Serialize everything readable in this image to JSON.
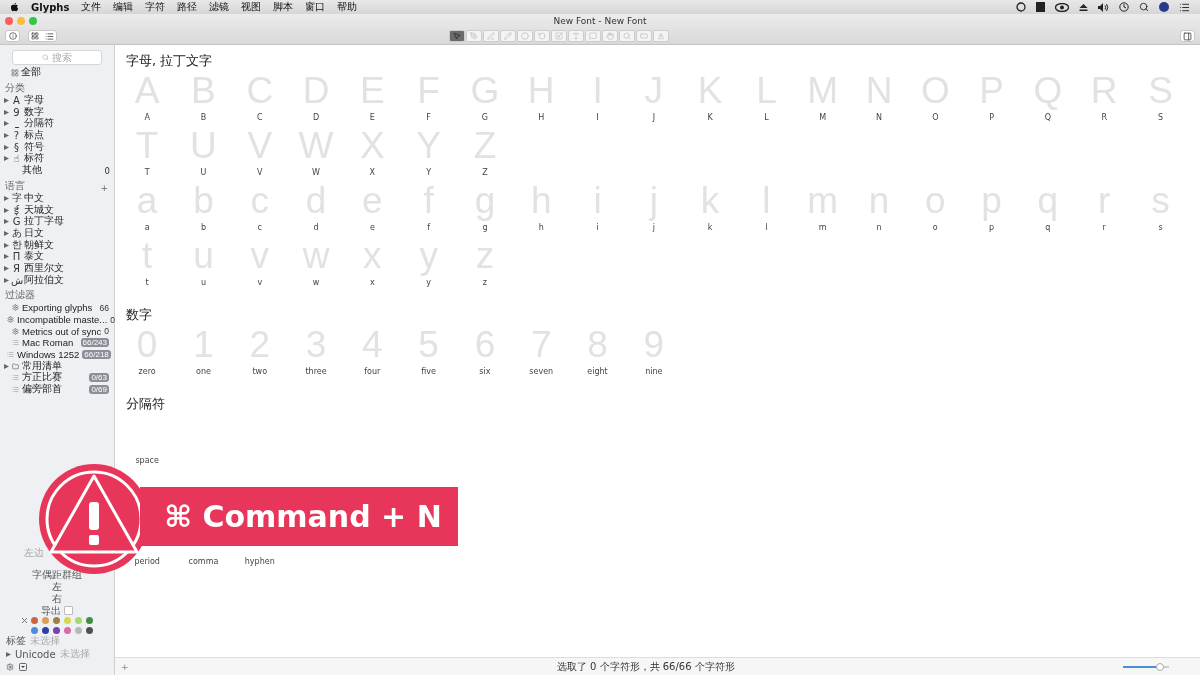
{
  "menu_bar": {
    "app": "Glyphs",
    "items": [
      "文件",
      "编辑",
      "字符",
      "路径",
      "滤镜",
      "视图",
      "脚本",
      "窗口",
      "帮助"
    ]
  },
  "window": {
    "title": "New Font - New Font"
  },
  "tools": [
    {
      "selected": true
    },
    {
      "selected": false
    },
    {
      "selected": false
    },
    {
      "selected": false
    },
    {
      "selected": false
    },
    {
      "selected": false
    },
    {
      "selected": false
    },
    {
      "selected": false
    },
    {
      "selected": false
    },
    {
      "selected": false
    },
    {
      "selected": false
    },
    {
      "selected": false
    },
    {
      "selected": false
    }
  ],
  "sidebar": {
    "search": {
      "placeholder": "搜索"
    },
    "all": "全部",
    "categories": {
      "title": "分类",
      "items": [
        {
          "symbol": "A",
          "label": "字母",
          "expanded": false
        },
        {
          "symbol": "9",
          "label": "数字",
          "expanded": false
        },
        {
          "symbol": "⎵",
          "label": "分隔符",
          "expanded": false
        },
        {
          "symbol": "?",
          "label": "标点",
          "expanded": false
        },
        {
          "symbol": "§",
          "label": "符号",
          "expanded": false
        },
        {
          "symbol": "☝",
          "label": "标符",
          "expanded": false
        },
        {
          "label": "其他",
          "count": "0"
        }
      ]
    },
    "languages": {
      "title": "语言",
      "add": "+",
      "items": [
        {
          "symbol": "字",
          "label": "中文",
          "expanded": false
        },
        {
          "symbol": "ई",
          "label": "天城文",
          "expanded": false
        },
        {
          "symbol": "G",
          "label": "拉丁字母",
          "expanded": false
        },
        {
          "symbol": "あ",
          "label": "日文",
          "expanded": false
        },
        {
          "symbol": "한",
          "label": "朝鲜文",
          "expanded": false
        },
        {
          "symbol": "П",
          "label": "泰文",
          "expanded": false
        },
        {
          "symbol": "Я",
          "label": "西里尔文",
          "expanded": false
        },
        {
          "symbol": "ش",
          "label": "阿拉伯文",
          "expanded": false
        }
      ]
    },
    "filters": {
      "title": "过滤器",
      "items": [
        {
          "kind": "smart",
          "label": "Exporting glyphs",
          "count": "66"
        },
        {
          "kind": "smart",
          "label": "Incompatible maste...",
          "count": "0"
        },
        {
          "kind": "smart",
          "label": "Metrics out of sync",
          "count": "0"
        },
        {
          "kind": "list",
          "label": "Mac Roman",
          "count": "66/243"
        },
        {
          "kind": "list",
          "label": "Windows 1252",
          "count": "66/218"
        },
        {
          "kind": "folder",
          "label": "常用清单",
          "expanded": false
        },
        {
          "kind": "list",
          "label": "方正比赛",
          "count": "0/63"
        },
        {
          "kind": "list",
          "label": "偏旁部首",
          "count": "0/69"
        }
      ]
    },
    "panel": {
      "left_margin": "左边",
      "kerning_group": "字偶距群组",
      "left": "左",
      "right": "右",
      "export": {
        "label": "导出",
        "checked": false
      },
      "colors": [
        {
          "color": "#c8673f"
        },
        {
          "color": "#d9a055"
        },
        {
          "color": "#9c8048"
        },
        {
          "color": "#d8d84a"
        },
        {
          "color": "#a8d870"
        },
        {
          "color": "#3f8f3f"
        },
        {
          "color": "#4a90d9"
        },
        {
          "color": "#2b3fa8"
        },
        {
          "color": "#7a3fb0"
        },
        {
          "color": "#d86aa8"
        },
        {
          "color": "#b8b8b8"
        },
        {
          "color": "#505050"
        }
      ],
      "tags": {
        "label": "标签",
        "value": "未选择"
      },
      "unicode": {
        "label": "Unicode",
        "value": "未选择",
        "expanded": false
      }
    }
  },
  "sections": [
    {
      "title": "字母, 拉丁文字",
      "groups": [
        [
          {
            "char": "A",
            "name": "A"
          },
          {
            "char": "B",
            "name": "B"
          },
          {
            "char": "C",
            "name": "C"
          },
          {
            "char": "D",
            "name": "D"
          },
          {
            "char": "E",
            "name": "E"
          },
          {
            "char": "F",
            "name": "F"
          },
          {
            "char": "G",
            "name": "G"
          },
          {
            "char": "H",
            "name": "H"
          },
          {
            "char": "I",
            "name": "I"
          },
          {
            "char": "J",
            "name": "J"
          },
          {
            "char": "K",
            "name": "K"
          },
          {
            "char": "L",
            "name": "L"
          },
          {
            "char": "M",
            "name": "M"
          },
          {
            "char": "N",
            "name": "N"
          },
          {
            "char": "O",
            "name": "O"
          },
          {
            "char": "P",
            "name": "P"
          },
          {
            "char": "Q",
            "name": "Q"
          },
          {
            "char": "R",
            "name": "R"
          },
          {
            "char": "S",
            "name": "S"
          },
          {
            "char": "T",
            "name": "T"
          },
          {
            "char": "U",
            "name": "U"
          },
          {
            "char": "V",
            "name": "V"
          },
          {
            "char": "W",
            "name": "W"
          },
          {
            "char": "X",
            "name": "X"
          },
          {
            "char": "Y",
            "name": "Y"
          },
          {
            "char": "Z",
            "name": "Z"
          }
        ],
        [
          {
            "char": "a",
            "name": "a"
          },
          {
            "char": "b",
            "name": "b"
          },
          {
            "char": "c",
            "name": "c"
          },
          {
            "char": "d",
            "name": "d"
          },
          {
            "char": "e",
            "name": "e"
          },
          {
            "char": "f",
            "name": "f"
          },
          {
            "char": "g",
            "name": "g"
          },
          {
            "char": "h",
            "name": "h"
          },
          {
            "char": "i",
            "name": "i"
          },
          {
            "char": "j",
            "name": "j"
          },
          {
            "char": "k",
            "name": "k"
          },
          {
            "char": "l",
            "name": "l"
          },
          {
            "char": "m",
            "name": "m"
          },
          {
            "char": "n",
            "name": "n"
          },
          {
            "char": "o",
            "name": "o"
          },
          {
            "char": "p",
            "name": "p"
          },
          {
            "char": "q",
            "name": "q"
          },
          {
            "char": "r",
            "name": "r"
          },
          {
            "char": "s",
            "name": "s"
          },
          {
            "char": "t",
            "name": "t"
          },
          {
            "char": "u",
            "name": "u"
          },
          {
            "char": "v",
            "name": "v"
          },
          {
            "char": "w",
            "name": "w"
          },
          {
            "char": "x",
            "name": "x"
          },
          {
            "char": "y",
            "name": "y"
          },
          {
            "char": "z",
            "name": "z"
          }
        ]
      ]
    },
    {
      "title": "数字",
      "groups": [
        [
          {
            "char": "0",
            "name": "zero"
          },
          {
            "char": "1",
            "name": "one"
          },
          {
            "char": "2",
            "name": "two"
          },
          {
            "char": "3",
            "name": "three"
          },
          {
            "char": "4",
            "name": "four"
          },
          {
            "char": "5",
            "name": "five"
          },
          {
            "char": "6",
            "name": "six"
          },
          {
            "char": "7",
            "name": "seven"
          },
          {
            "char": "8",
            "name": "eight"
          },
          {
            "char": "9",
            "name": "nine"
          }
        ]
      ]
    },
    {
      "title": "分隔符",
      "groups": [
        [
          {
            "name": "space"
          }
        ]
      ]
    },
    {
      "groups": [
        [
          {
            "name": "period"
          },
          {
            "name": "comma"
          },
          {
            "name": "hyphen"
          }
        ]
      ]
    }
  ],
  "bottom_bar": {
    "add": "+",
    "status": "选取了 0 个字符形，共 66/66 个字符形",
    "zoom": {
      "level": 0.8
    }
  },
  "overlay": {
    "shortcut": "⌘ Command + N"
  }
}
